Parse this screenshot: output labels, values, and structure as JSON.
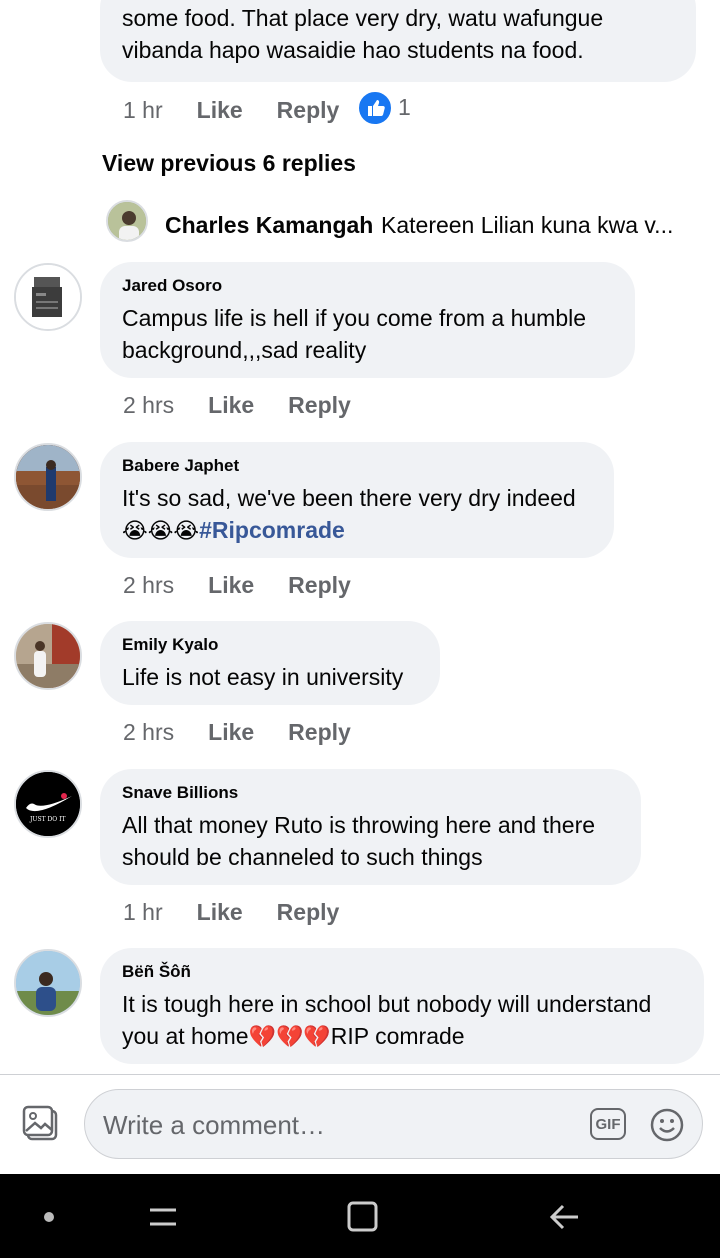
{
  "top_comment": {
    "text": "some food. That place very dry, watu wafungue vibanda hapo wasaidie hao students na food.",
    "time": "1 hr",
    "like": "Like",
    "reply": "Reply",
    "reaction_count": "1"
  },
  "view_previous": "View previous 6 replies",
  "latest_reply": {
    "name": "Charles Kamangah",
    "text": "Katereen Lilian kuna kwa v..."
  },
  "comments": [
    {
      "name": "Jared Osoro",
      "text": "Campus life is hell if you come from a humble background,,,sad reality",
      "time": "2 hrs",
      "like": "Like",
      "reply": "Reply"
    },
    {
      "name": "Babere Japhet",
      "text": "It's so sad, we've been there very dry indeed",
      "emojis": "😭😭😭",
      "hashtag": "#Ripcomrade",
      "time": "2 hrs",
      "like": "Like",
      "reply": "Reply"
    },
    {
      "name": "Emily Kyalo",
      "text": "Life is not easy in university",
      "time": "2 hrs",
      "like": "Like",
      "reply": "Reply"
    },
    {
      "name": "Snave Billions",
      "text": "All that money Ruto is throwing here and there should be channeled to such things",
      "time": "1 hr",
      "like": "Like",
      "reply": "Reply",
      "avatar_text": "JUST DO IT"
    },
    {
      "name": "Bëñ Šôñ",
      "text_a": "It is tough here in school but nobody will understand you at home",
      "emojis": "💔💔💔",
      "text_b": "RIP comrade"
    }
  ],
  "composer": {
    "placeholder": "Write a comment…",
    "gif": "GIF"
  },
  "colors": {
    "bubble": "#f0f2f5",
    "meta_text": "#65676b",
    "hashtag": "#385898",
    "like_blue": "#1877f2"
  }
}
